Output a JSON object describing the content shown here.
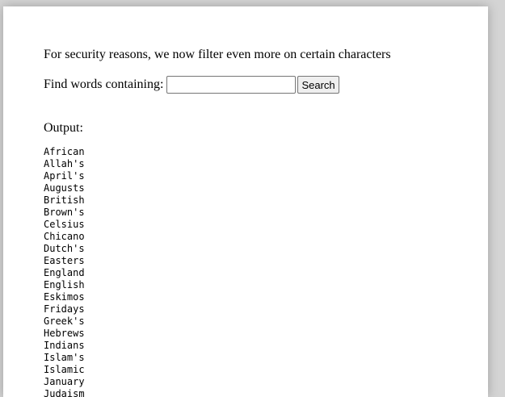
{
  "notice": "For security reasons, we now filter even more on certain characters",
  "search": {
    "label": "Find words containing:",
    "value": "",
    "placeholder": "",
    "button_label": "Search"
  },
  "output": {
    "label": "Output:",
    "words": [
      "African",
      "Allah's",
      "April's",
      "Augusts",
      "British",
      "Brown's",
      "Celsius",
      "Chicano",
      "Dutch's",
      "Easters",
      "England",
      "English",
      "Eskimos",
      "Fridays",
      "Greek's",
      "Hebrews",
      "Indians",
      "Islam's",
      "Islamic",
      "January",
      "Judaism"
    ]
  }
}
